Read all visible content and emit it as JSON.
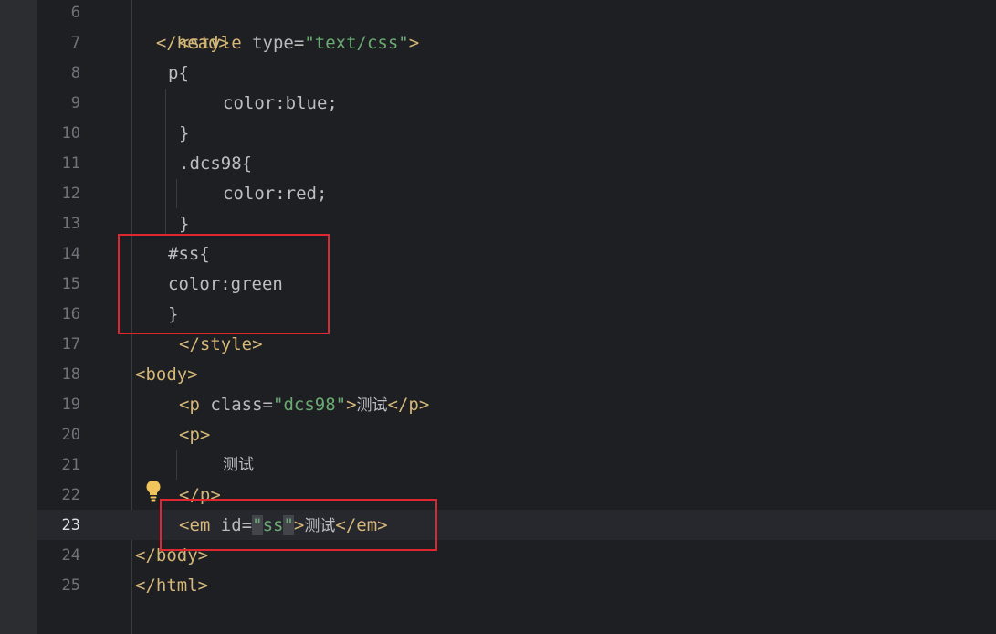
{
  "editor": {
    "line_numbers": [
      "6",
      "7",
      "8",
      "9",
      "10",
      "11",
      "12",
      "13",
      "14",
      "15",
      "16",
      "17",
      "18",
      "19",
      "20",
      "21",
      "22",
      "23",
      "24",
      "25"
    ],
    "current_line": "23"
  },
  "code": {
    "l6": {
      "close_head": "</head>"
    },
    "l7": {
      "open": "<style",
      "attr": "type",
      "eq": "=",
      "val": "\"text/css\"",
      "close": ">"
    },
    "l8": {
      "text": "p{"
    },
    "l9": {
      "text": "color:blue;"
    },
    "l10": {
      "text": "}"
    },
    "l11": {
      "text": ".dcs98{"
    },
    "l12": {
      "text": "color:red;"
    },
    "l13": {
      "text": "}"
    },
    "l14": {
      "text": "#ss{"
    },
    "l15": {
      "text": "color:green"
    },
    "l16": {
      "text": "}"
    },
    "l17": {
      "text": "</style>"
    },
    "l18": {
      "text": "<body>"
    },
    "l19": {
      "open": "<p",
      "attr": "class",
      "eq": "=",
      "val": "\"dcs98\"",
      "gt": ">",
      "content": "测试",
      "close": "</p>"
    },
    "l20": {
      "text": "<p>"
    },
    "l21": {
      "content": "测试"
    },
    "l22": {
      "text": "</p>"
    },
    "l23": {
      "open": "<em",
      "attr": "id",
      "eq": "=",
      "q1": "\"",
      "val": "ss",
      "q2": "\"",
      "gt": ">",
      "content": "测试",
      "close": "</em>"
    },
    "l24": {
      "text": "</body>"
    },
    "l25": {
      "text": "</html>"
    }
  },
  "colors": {
    "tag": "#d5b778",
    "string": "#6aab73",
    "text": "#bcbec4",
    "highlight_box": "#e0262f",
    "background": "#1e1f22"
  },
  "icons": [
    "lightbulb-icon"
  ]
}
